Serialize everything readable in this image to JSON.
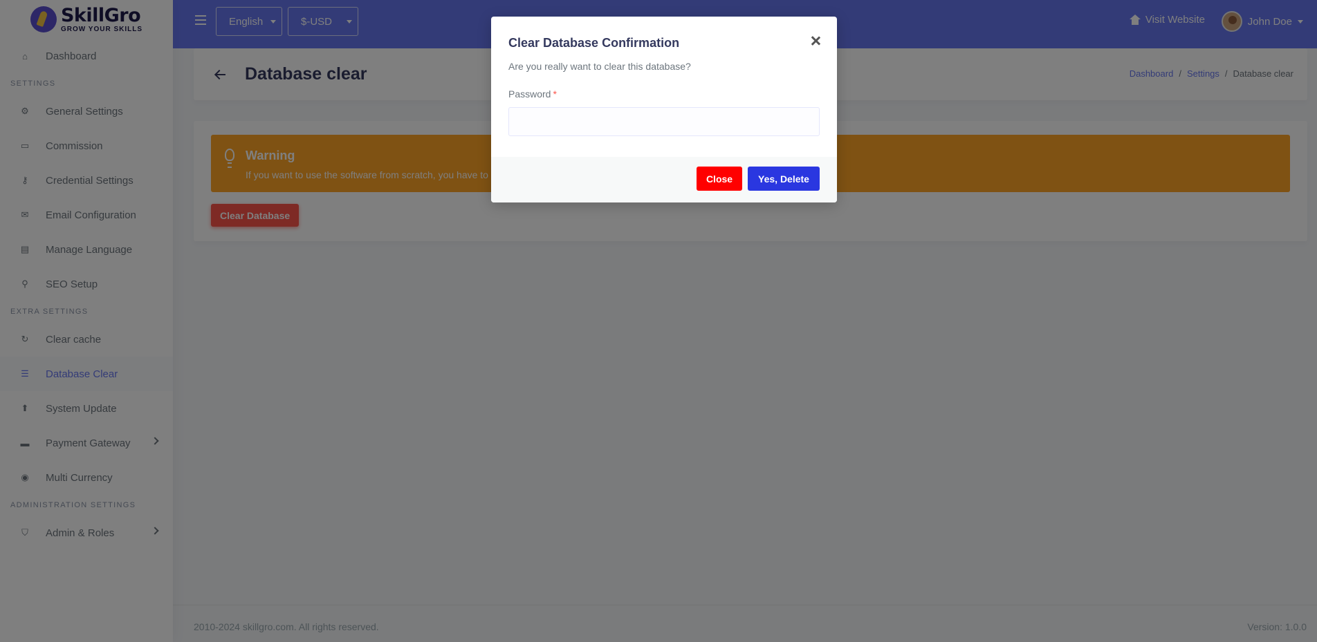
{
  "brand": {
    "name": "SkillGro",
    "tagline": "GROW YOUR SKILLS"
  },
  "topbar": {
    "language": "English",
    "currency": "$-USD",
    "visit_label": "Visit Website",
    "user_name": "John Doe"
  },
  "sidebar": {
    "dashboard": "Dashboard",
    "settings_header": "SETTINGS",
    "settings_items": [
      {
        "label": "General Settings",
        "icon": "gear-icon"
      },
      {
        "label": "Commission",
        "icon": "money-icon"
      },
      {
        "label": "Credential Settings",
        "icon": "key-icon"
      },
      {
        "label": "Email Configuration",
        "icon": "envelope-icon"
      },
      {
        "label": "Manage Language",
        "icon": "language-icon"
      },
      {
        "label": "SEO Setup",
        "icon": "search-icon"
      }
    ],
    "extra_header": "EXTRA SETTINGS",
    "extra_items": [
      {
        "label": "Clear cache",
        "icon": "refresh-icon"
      },
      {
        "label": "Database Clear",
        "icon": "database-icon",
        "active": true
      },
      {
        "label": "System Update",
        "icon": "upload-icon"
      },
      {
        "label": "Payment Gateway",
        "icon": "credit-card-icon"
      },
      {
        "label": "Multi Currency",
        "icon": "coins-icon"
      }
    ],
    "admin_header": "ADMINISTRATION SETTINGS",
    "admin_items": [
      {
        "label": "Admin & Roles",
        "icon": "shield-icon"
      }
    ]
  },
  "page": {
    "title": "Database clear",
    "breadcrumb": [
      "Dashboard",
      "Settings",
      "Database clear"
    ],
    "alert_title": "Warning",
    "alert_text": "If you want to use the software from scratch, you have to",
    "clear_button": "Clear Database"
  },
  "modal": {
    "title": "Clear Database Confirmation",
    "text": "Are you really want to clear this database?",
    "password_label": "Password",
    "required_mark": "*",
    "password_value": "",
    "close_button": "Close",
    "delete_button": "Yes, Delete"
  },
  "footer": {
    "copyright": "2010-2024 skillgro.com. All rights reserved.",
    "version": "Version: 1.0.0"
  },
  "colors": {
    "primary": "#6777ef",
    "warning": "#ffa426",
    "danger": "#fc544b",
    "close_red": "#ff0000",
    "delete_blue": "#2a37e0"
  }
}
